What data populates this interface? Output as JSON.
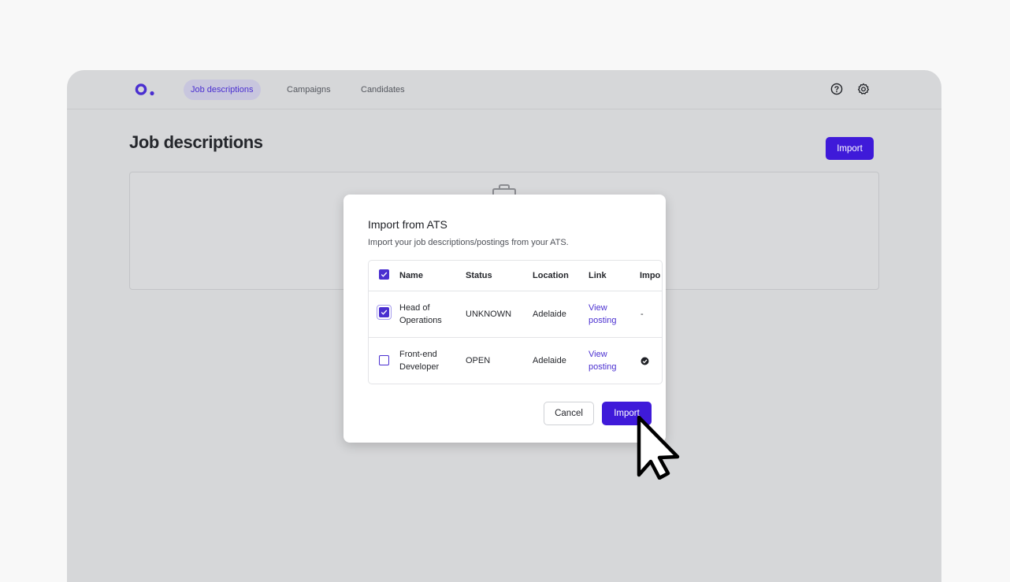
{
  "nav": {
    "logo_icon": "brand-logo",
    "tabs": [
      {
        "label": "Job descriptions",
        "active": true
      },
      {
        "label": "Campaigns",
        "active": false
      },
      {
        "label": "Candidates",
        "active": false
      }
    ],
    "icons": [
      "help-circle-icon",
      "settings-gear-icon"
    ]
  },
  "page": {
    "title": "Job descriptions",
    "import_label": "Import",
    "empty_state_icon": "briefcase-icon"
  },
  "modal": {
    "title": "Import from ATS",
    "subtitle": "Import your job descriptions/postings from your ATS.",
    "columns": [
      "Name",
      "Status",
      "Location",
      "Link",
      "Impo"
    ],
    "select_all_checked": true,
    "rows": [
      {
        "name_line1": "Head of",
        "name_line2": "Operations",
        "status": "UNKNOWN",
        "location": "Adelaide",
        "link_line1": "View",
        "link_line2": "posting",
        "imported": "-",
        "checked": true
      },
      {
        "name_line1": "Front-end",
        "name_line2": "Developer",
        "status": "OPEN",
        "location": "Adelaide",
        "link_line1": "View",
        "link_line2": "posting",
        "imported": "check-circle-icon",
        "checked": false
      }
    ],
    "cancel_label": "Cancel",
    "import_label": "Import"
  },
  "colors": {
    "accent": "#3f1ad9",
    "link": "#4a2fd0",
    "overlay": "#d6d7d9",
    "background": "#f8f8f8"
  }
}
